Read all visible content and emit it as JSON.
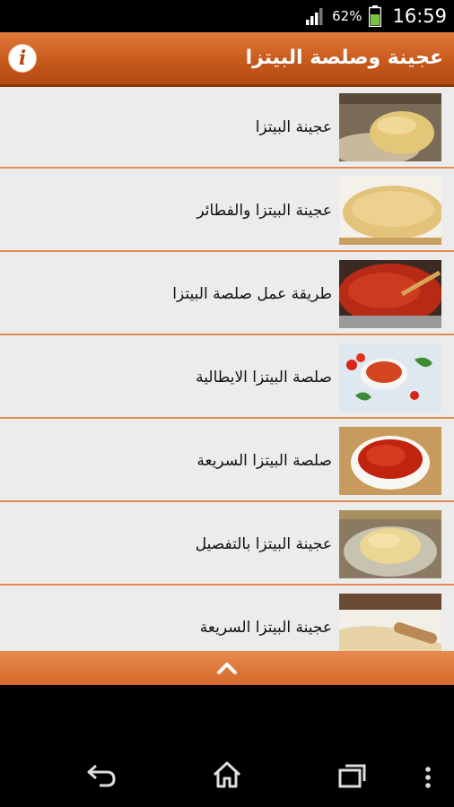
{
  "status_bar": {
    "battery_percent": "62%",
    "time": "16:59",
    "signal_icon": "signal-icon",
    "battery_icon": "battery-icon"
  },
  "app_bar": {
    "title": "عجينة وصلصة البيتزا",
    "info_icon": "info-icon",
    "info_glyph": "i"
  },
  "list": {
    "items": [
      {
        "label": "عجينة البيتزا",
        "thumbnail": "dough-ball-photo"
      },
      {
        "label": "عجينة البيتزا والفطائر",
        "thumbnail": "round-dough-photo"
      },
      {
        "label": "طريقة عمل صلصة البيتزا",
        "thumbnail": "sauce-pot-photo"
      },
      {
        "label": "صلصة البيتزا الايطالية",
        "thumbnail": "sauce-bowl-tomatoes-photo"
      },
      {
        "label": "صلصة البيتزا السريعة",
        "thumbnail": "sauce-bowl-photo"
      },
      {
        "label": "عجينة البيتزا بالتفصيل",
        "thumbnail": "dough-in-bowl-photo"
      },
      {
        "label": "عجينة البيتزا السريعة",
        "thumbnail": "rolling-pin-photo"
      }
    ]
  },
  "bottom_bar": {
    "icon": "chevron-up-icon"
  },
  "nav_bar": {
    "back": "back-icon",
    "home": "home-icon",
    "recents": "recents-icon",
    "menu": "overflow-menu-icon"
  },
  "colors": {
    "accent": "#c75a1c",
    "separator": "#e48a4f",
    "list_background": "#ececec"
  }
}
